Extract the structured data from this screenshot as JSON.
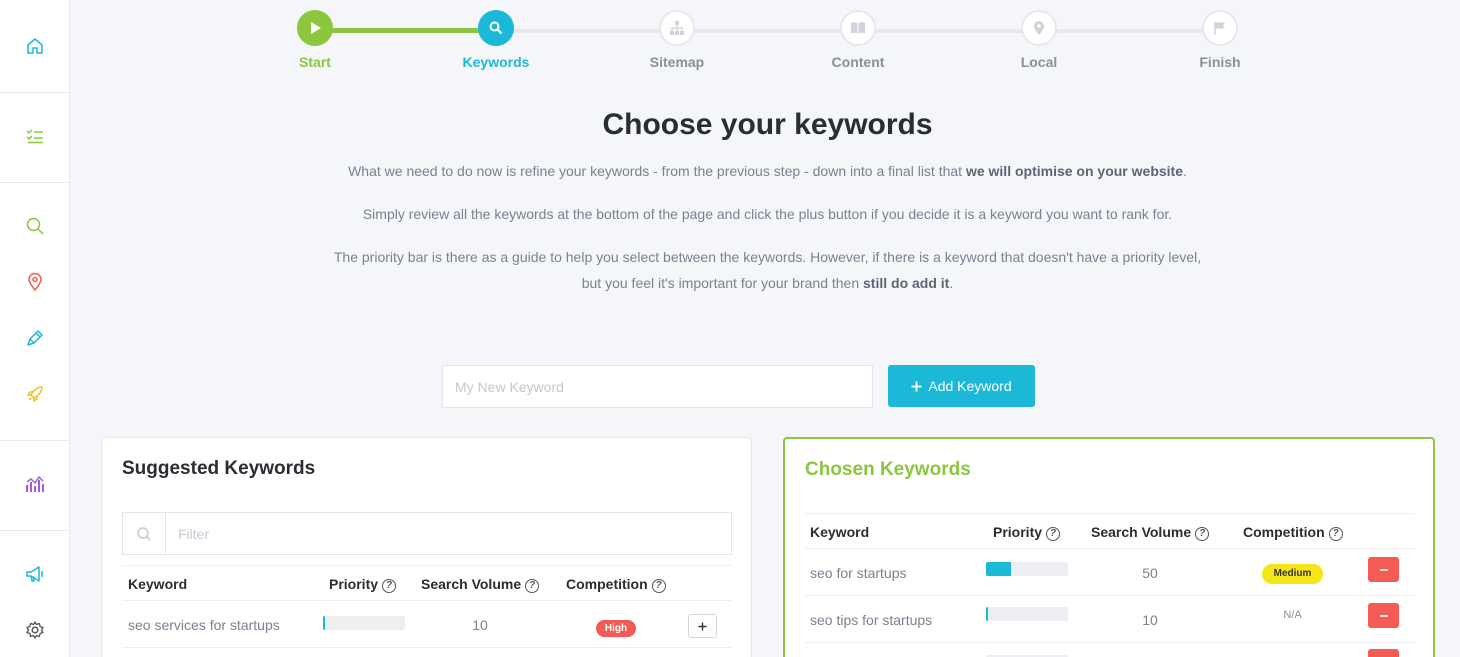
{
  "sidebar": {
    "items": [
      {
        "icon": "home-icon",
        "color": "#1bb8d8"
      },
      {
        "icon": "checklist-icon",
        "color": "#8cc63f"
      },
      {
        "icon": "search-icon",
        "color": "#8cc63f"
      },
      {
        "icon": "location-pin-icon",
        "color": "#f25c54"
      },
      {
        "icon": "pen-icon",
        "color": "#1bb8d8"
      },
      {
        "icon": "rocket-icon",
        "color": "#f4c21c"
      },
      {
        "icon": "analytics-icon",
        "color": "#a35cd6"
      },
      {
        "icon": "megaphone-icon",
        "color": "#1bb8d8"
      },
      {
        "icon": "gear-icon",
        "color": "#555555"
      }
    ]
  },
  "stepper": {
    "steps": [
      {
        "label": "Start",
        "icon": "play-icon",
        "state": "done"
      },
      {
        "label": "Keywords",
        "icon": "search-icon",
        "state": "active"
      },
      {
        "label": "Sitemap",
        "icon": "sitemap-icon",
        "state": "todo"
      },
      {
        "label": "Content",
        "icon": "book-icon",
        "state": "todo"
      },
      {
        "label": "Local",
        "icon": "location-pin-icon",
        "state": "todo"
      },
      {
        "label": "Finish",
        "icon": "flag-icon",
        "state": "todo"
      }
    ]
  },
  "intro": {
    "title": "Choose your keywords",
    "p1_start": "What we need to do now is refine your keywords - from the previous step - down into a final list that ",
    "p1_bold": "we will optimise on your website",
    "p1_end": ".",
    "p2": "Simply review all the keywords at the bottom of the page and click the plus button if you decide it is a keyword you want to rank for.",
    "p3_start": "The priority bar is there as a guide to help you select between the keywords. However, if there is a keyword that doesn't have a priority level, but you feel it's important for your brand then ",
    "p3_bold": "still do add it",
    "p3_end": "."
  },
  "add_keyword": {
    "placeholder": "My New Keyword",
    "button_label": "Add Keyword"
  },
  "suggested": {
    "title": "Suggested Keywords",
    "filter_placeholder": "Filter",
    "columns": [
      "Keyword",
      "Priority",
      "Search Volume",
      "Competition"
    ],
    "rows": [
      {
        "keyword": "seo services for startups",
        "priority": 0.03,
        "volume": "10",
        "competition": "High"
      }
    ]
  },
  "chosen": {
    "title": "Chosen Keywords",
    "columns": [
      "Keyword",
      "Priority",
      "Search Volume",
      "Competition"
    ],
    "rows": [
      {
        "keyword": "seo for startups",
        "priority": 0.3,
        "volume": "50",
        "competition": "Medium"
      },
      {
        "keyword": "seo tips for startups",
        "priority": 0.03,
        "volume": "10",
        "competition": "N/A"
      }
    ]
  },
  "colors": {
    "accent": "#1bb8d8",
    "success": "#8cc63f",
    "danger": "#f25c54",
    "warning": "#f4e619"
  }
}
